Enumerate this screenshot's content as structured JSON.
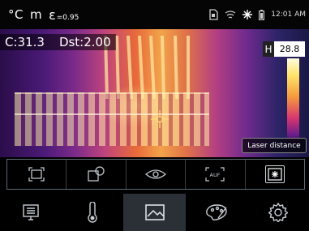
{
  "status": {
    "unit": "°C",
    "mode_m": "m",
    "emissivity_symbol": "ε",
    "emissivity_value": "=0.95",
    "time": "12:01 AM"
  },
  "readout": {
    "center_temp": "C:31.3",
    "distance": "Dst:2.00"
  },
  "scale": {
    "high_label": "H",
    "high_value": "28.8"
  },
  "tooltip": "Laser distance",
  "mode_toolbar": [
    {
      "icon": "fullscreen-frame-icon"
    },
    {
      "icon": "picture-in-picture-icon"
    },
    {
      "icon": "eye-icon"
    },
    {
      "icon": "auto-focus-icon"
    },
    {
      "icon": "laser-distance-icon",
      "selected": true
    }
  ],
  "bottom_menu": [
    {
      "icon": "gallery-icon"
    },
    {
      "icon": "thermometer-icon"
    },
    {
      "icon": "image-mode-icon",
      "selected": true
    },
    {
      "icon": "palette-icon"
    },
    {
      "icon": "settings-gear-icon"
    }
  ],
  "colors": {
    "accent": "#ffd54a",
    "selected_bg": "#2b3037"
  }
}
